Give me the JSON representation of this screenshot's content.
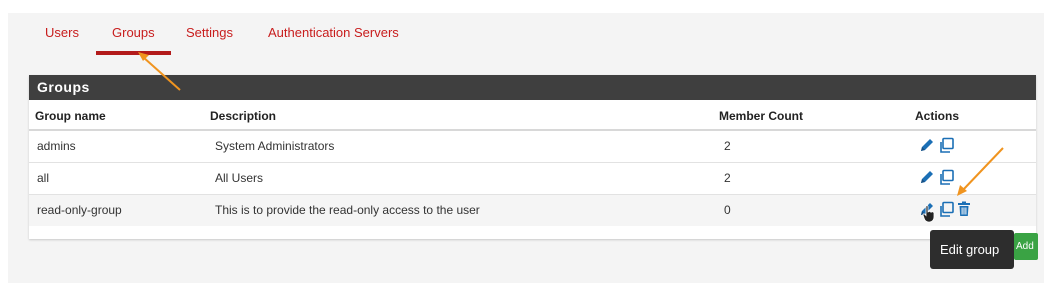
{
  "tabs": [
    {
      "label": "Users"
    },
    {
      "label": "Groups"
    },
    {
      "label": "Settings"
    },
    {
      "label": "Authentication Servers"
    }
  ],
  "active_tab": "Groups",
  "table": {
    "title": "Groups",
    "columns": [
      "Group name",
      "Description",
      "Member Count",
      "Actions"
    ],
    "rows": [
      {
        "name": "admins",
        "description": "System Administrators",
        "count": "2"
      },
      {
        "name": "all",
        "description": "All Users",
        "count": "2"
      },
      {
        "name": "read-only-group",
        "description": "This is to provide the read-only access to the user",
        "count": "0"
      }
    ]
  },
  "tooltip": "Edit group",
  "add_label": "Add",
  "icons": {
    "edit": "pencil-icon",
    "copy": "copy-icon",
    "delete": "trash-icon",
    "cursor": "hand-pointer-icon"
  },
  "colors": {
    "tab_text": "#c81d1d",
    "tab_active_underline": "#b31b1b",
    "table_header_bg": "#3f3f3f",
    "icon_blue": "#1b6fb5",
    "add_green": "#3aa344",
    "annotation_arrow": "#f0941f"
  }
}
